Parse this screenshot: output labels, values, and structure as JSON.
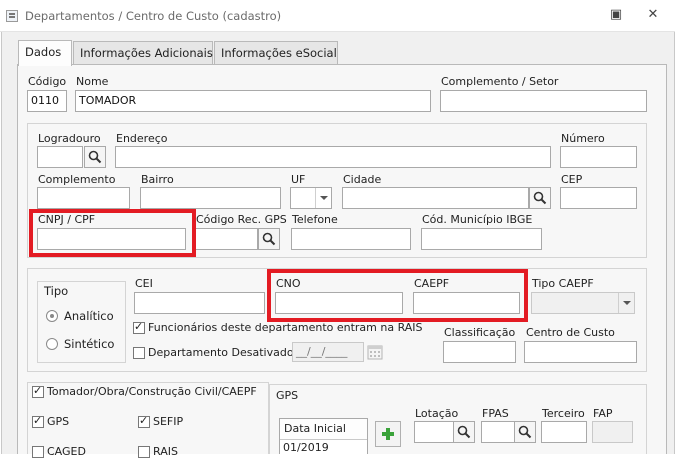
{
  "window": {
    "title": "Departamentos / Centro de Custo (cadastro)",
    "restore_glyph": "▣",
    "close_glyph": "✕"
  },
  "tabs": [
    {
      "label": "Dados",
      "active": true
    },
    {
      "label": "Informações Adicionais",
      "active": false
    },
    {
      "label": "Informações eSocial",
      "active": false
    }
  ],
  "fields": {
    "codigo": {
      "label": "Código",
      "value": "0110"
    },
    "nome": {
      "label": "Nome",
      "value": "TOMADOR"
    },
    "complemento_setor": {
      "label": "Complemento / Setor",
      "value": ""
    },
    "logradouro": {
      "label": "Logradouro",
      "value": ""
    },
    "endereco": {
      "label": "Endereço",
      "value": ""
    },
    "numero": {
      "label": "Número",
      "value": ""
    },
    "complemento": {
      "label": "Complemento",
      "value": ""
    },
    "bairro": {
      "label": "Bairro",
      "value": ""
    },
    "uf": {
      "label": "UF",
      "value": ""
    },
    "cidade": {
      "label": "Cidade",
      "value": ""
    },
    "cep": {
      "label": "CEP",
      "value": ""
    },
    "cnpj_cpf": {
      "label": "CNPJ / CPF",
      "value": ""
    },
    "codigo_rec_gps": {
      "label": "Código Rec. GPS",
      "value": ""
    },
    "telefone": {
      "label": "Telefone",
      "value": ""
    },
    "cod_municipio_ibge": {
      "label": "Cód. Município IBGE",
      "value": ""
    },
    "cei": {
      "label": "CEI",
      "value": ""
    },
    "cno": {
      "label": "CNO",
      "value": ""
    },
    "caepf": {
      "label": "CAEPF",
      "value": ""
    },
    "tipo_caepf": {
      "label": "Tipo CAEPF",
      "value": ""
    },
    "classificacao": {
      "label": "Classificação",
      "value": ""
    },
    "centro_custo": {
      "label": "Centro de Custo",
      "value": ""
    },
    "data_desativado": {
      "value": "__/__/____"
    }
  },
  "tipo_group": {
    "title": "Tipo",
    "options": [
      {
        "label": "Analítico",
        "selected": true
      },
      {
        "label": "Sintético",
        "selected": false
      }
    ]
  },
  "checks": {
    "funcionarios_rais": {
      "label": "Funcionários deste departamento entram na RAIS",
      "checked": true
    },
    "departamento_desativado": {
      "label": "Departamento Desativado",
      "checked": false
    },
    "tomador_obra": {
      "label": "Tomador/Obra/Construção Civil/CAEPF",
      "checked": true
    },
    "gps": {
      "label": "GPS",
      "checked": true
    },
    "sefip": {
      "label": "SEFIP",
      "checked": true
    },
    "caged": {
      "label": "CAGED",
      "checked": false
    },
    "rais": {
      "label": "RAIS",
      "checked": false
    }
  },
  "gps_group": {
    "title": "GPS",
    "grid_header": "Data Inicial",
    "grid_rows": [
      "01/2019"
    ],
    "lotacao": "Lotação",
    "fpas": "FPAS",
    "terceiro": "Terceiro",
    "fap": "FAP"
  },
  "colors": {
    "highlight": "#e31b23",
    "plus": "#3aa23a"
  }
}
